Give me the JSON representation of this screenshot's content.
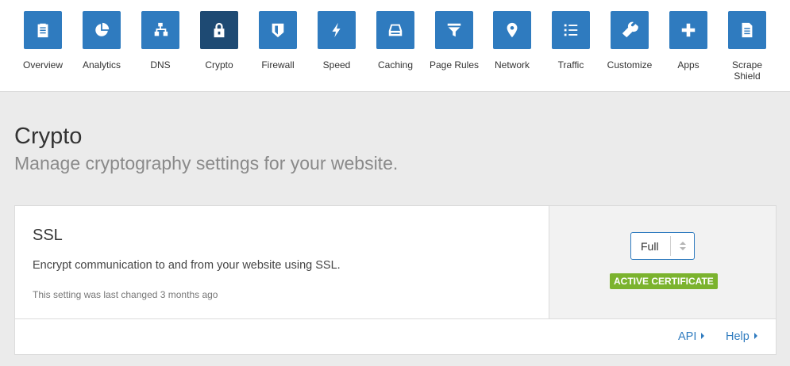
{
  "nav": {
    "items": [
      {
        "label": "Overview",
        "icon": "clipboard-icon",
        "active": false
      },
      {
        "label": "Analytics",
        "icon": "pie-chart-icon",
        "active": false
      },
      {
        "label": "DNS",
        "icon": "sitemap-icon",
        "active": false
      },
      {
        "label": "Crypto",
        "icon": "lock-icon",
        "active": true
      },
      {
        "label": "Firewall",
        "icon": "shield-icon",
        "active": false
      },
      {
        "label": "Speed",
        "icon": "bolt-icon",
        "active": false
      },
      {
        "label": "Caching",
        "icon": "hard-drive-icon",
        "active": false
      },
      {
        "label": "Page Rules",
        "icon": "filter-icon",
        "active": false
      },
      {
        "label": "Network",
        "icon": "map-pin-icon",
        "active": false
      },
      {
        "label": "Traffic",
        "icon": "list-icon",
        "active": false
      },
      {
        "label": "Customize",
        "icon": "wrench-icon",
        "active": false
      },
      {
        "label": "Apps",
        "icon": "plus-icon",
        "active": false
      },
      {
        "label": "Scrape Shield",
        "icon": "document-icon",
        "active": false
      }
    ]
  },
  "page": {
    "title": "Crypto",
    "subtitle": "Manage cryptography settings for your website."
  },
  "ssl": {
    "title": "SSL",
    "description": "Encrypt communication to and from your website using SSL.",
    "last_changed": "This setting was last changed 3 months ago",
    "mode": "Full",
    "badge": "ACTIVE CERTIFICATE"
  },
  "footer": {
    "api": "API",
    "help": "Help"
  },
  "colors": {
    "accent": "#2f7bbf",
    "active_tile": "#1e4a73",
    "badge": "#7bb32e",
    "page_bg": "#ebebeb"
  }
}
